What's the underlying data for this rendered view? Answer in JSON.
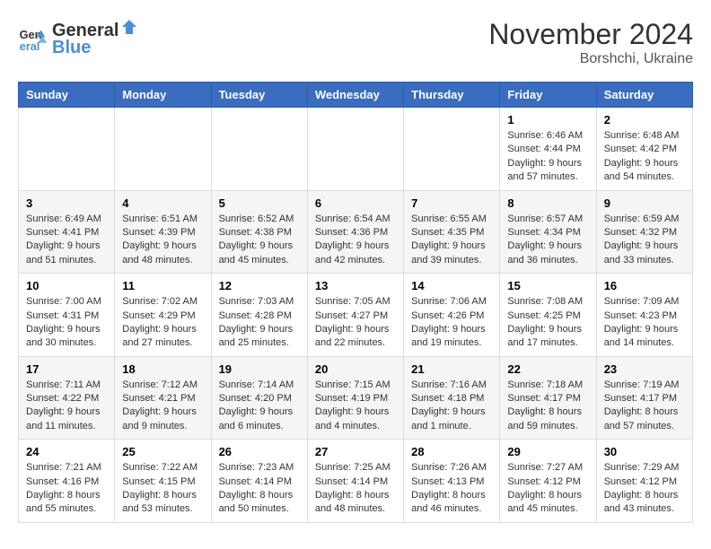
{
  "logo": {
    "line1": "General",
    "line2": "Blue"
  },
  "title": "November 2024",
  "location": "Borshchi, Ukraine",
  "days_of_week": [
    "Sunday",
    "Monday",
    "Tuesday",
    "Wednesday",
    "Thursday",
    "Friday",
    "Saturday"
  ],
  "weeks": [
    [
      {
        "day": "",
        "info": ""
      },
      {
        "day": "",
        "info": ""
      },
      {
        "day": "",
        "info": ""
      },
      {
        "day": "",
        "info": ""
      },
      {
        "day": "",
        "info": ""
      },
      {
        "day": "1",
        "info": "Sunrise: 6:46 AM\nSunset: 4:44 PM\nDaylight: 9 hours and 57 minutes."
      },
      {
        "day": "2",
        "info": "Sunrise: 6:48 AM\nSunset: 4:42 PM\nDaylight: 9 hours and 54 minutes."
      }
    ],
    [
      {
        "day": "3",
        "info": "Sunrise: 6:49 AM\nSunset: 4:41 PM\nDaylight: 9 hours and 51 minutes."
      },
      {
        "day": "4",
        "info": "Sunrise: 6:51 AM\nSunset: 4:39 PM\nDaylight: 9 hours and 48 minutes."
      },
      {
        "day": "5",
        "info": "Sunrise: 6:52 AM\nSunset: 4:38 PM\nDaylight: 9 hours and 45 minutes."
      },
      {
        "day": "6",
        "info": "Sunrise: 6:54 AM\nSunset: 4:36 PM\nDaylight: 9 hours and 42 minutes."
      },
      {
        "day": "7",
        "info": "Sunrise: 6:55 AM\nSunset: 4:35 PM\nDaylight: 9 hours and 39 minutes."
      },
      {
        "day": "8",
        "info": "Sunrise: 6:57 AM\nSunset: 4:34 PM\nDaylight: 9 hours and 36 minutes."
      },
      {
        "day": "9",
        "info": "Sunrise: 6:59 AM\nSunset: 4:32 PM\nDaylight: 9 hours and 33 minutes."
      }
    ],
    [
      {
        "day": "10",
        "info": "Sunrise: 7:00 AM\nSunset: 4:31 PM\nDaylight: 9 hours and 30 minutes."
      },
      {
        "day": "11",
        "info": "Sunrise: 7:02 AM\nSunset: 4:29 PM\nDaylight: 9 hours and 27 minutes."
      },
      {
        "day": "12",
        "info": "Sunrise: 7:03 AM\nSunset: 4:28 PM\nDaylight: 9 hours and 25 minutes."
      },
      {
        "day": "13",
        "info": "Sunrise: 7:05 AM\nSunset: 4:27 PM\nDaylight: 9 hours and 22 minutes."
      },
      {
        "day": "14",
        "info": "Sunrise: 7:06 AM\nSunset: 4:26 PM\nDaylight: 9 hours and 19 minutes."
      },
      {
        "day": "15",
        "info": "Sunrise: 7:08 AM\nSunset: 4:25 PM\nDaylight: 9 hours and 17 minutes."
      },
      {
        "day": "16",
        "info": "Sunrise: 7:09 AM\nSunset: 4:23 PM\nDaylight: 9 hours and 14 minutes."
      }
    ],
    [
      {
        "day": "17",
        "info": "Sunrise: 7:11 AM\nSunset: 4:22 PM\nDaylight: 9 hours and 11 minutes."
      },
      {
        "day": "18",
        "info": "Sunrise: 7:12 AM\nSunset: 4:21 PM\nDaylight: 9 hours and 9 minutes."
      },
      {
        "day": "19",
        "info": "Sunrise: 7:14 AM\nSunset: 4:20 PM\nDaylight: 9 hours and 6 minutes."
      },
      {
        "day": "20",
        "info": "Sunrise: 7:15 AM\nSunset: 4:19 PM\nDaylight: 9 hours and 4 minutes."
      },
      {
        "day": "21",
        "info": "Sunrise: 7:16 AM\nSunset: 4:18 PM\nDaylight: 9 hours and 1 minute."
      },
      {
        "day": "22",
        "info": "Sunrise: 7:18 AM\nSunset: 4:17 PM\nDaylight: 8 hours and 59 minutes."
      },
      {
        "day": "23",
        "info": "Sunrise: 7:19 AM\nSunset: 4:17 PM\nDaylight: 8 hours and 57 minutes."
      }
    ],
    [
      {
        "day": "24",
        "info": "Sunrise: 7:21 AM\nSunset: 4:16 PM\nDaylight: 8 hours and 55 minutes."
      },
      {
        "day": "25",
        "info": "Sunrise: 7:22 AM\nSunset: 4:15 PM\nDaylight: 8 hours and 53 minutes."
      },
      {
        "day": "26",
        "info": "Sunrise: 7:23 AM\nSunset: 4:14 PM\nDaylight: 8 hours and 50 minutes."
      },
      {
        "day": "27",
        "info": "Sunrise: 7:25 AM\nSunset: 4:14 PM\nDaylight: 8 hours and 48 minutes."
      },
      {
        "day": "28",
        "info": "Sunrise: 7:26 AM\nSunset: 4:13 PM\nDaylight: 8 hours and 46 minutes."
      },
      {
        "day": "29",
        "info": "Sunrise: 7:27 AM\nSunset: 4:12 PM\nDaylight: 8 hours and 45 minutes."
      },
      {
        "day": "30",
        "info": "Sunrise: 7:29 AM\nSunset: 4:12 PM\nDaylight: 8 hours and 43 minutes."
      }
    ]
  ]
}
